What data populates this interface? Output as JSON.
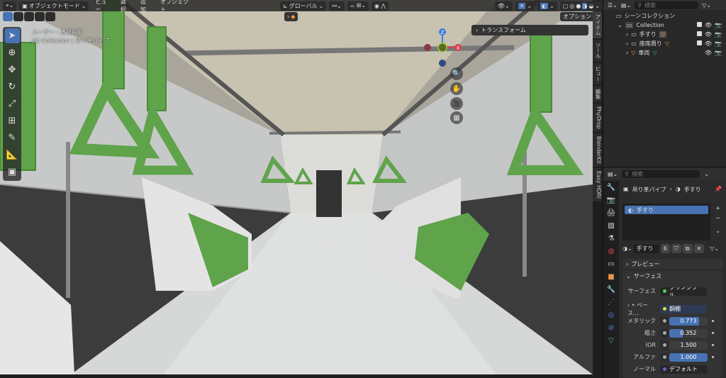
{
  "header": {
    "mode": "オブジェクトモード",
    "menus": [
      "ビュー",
      "選択",
      "追加",
      "オブジェクト"
    ],
    "orientation": "グローバル"
  },
  "viewport": {
    "view_label": "ユーザー・透視投影",
    "object_info": "(0) Collection | 吊り革パイプ",
    "options": "オプション",
    "transform_panel": "トランスフォーム",
    "gizmo": {
      "z": "Z",
      "x": "X"
    }
  },
  "sidebar_tabs": [
    "アイテム",
    "ツール",
    "ビュー",
    "編集",
    "PhyDrop",
    "BlenderKit",
    "Easy HDRI"
  ],
  "outliner": {
    "search_placeholder": "検索",
    "scene_collection": "シーンコレクション",
    "collection": "Collection",
    "items": [
      {
        "name": "手すり"
      },
      {
        "name": "座席周り"
      },
      {
        "name": "車両"
      }
    ]
  },
  "properties": {
    "search_placeholder": "検索",
    "breadcrumb_object": "吊り革パイプ",
    "breadcrumb_material": "手すり",
    "slot": "手すり",
    "material_name": "手すり",
    "users": "6",
    "preview_panel": "プレビュー",
    "surface_panel": "サーフェス",
    "surface": {
      "label": "サーフェス",
      "value": "プリンシプル..."
    },
    "base": {
      "label": "ベース...",
      "value": "鋼棚"
    },
    "metallic": {
      "label": "メタリック",
      "value": "0.773",
      "fraction": 0.773
    },
    "roughness": {
      "label": "粗さ",
      "value": "0.352",
      "fraction": 0.352
    },
    "ior": {
      "label": "IOR",
      "value": "1.500",
      "fraction": 0
    },
    "alpha": {
      "label": "アルファ",
      "value": "1.000",
      "fraction": 1.0
    },
    "normal": {
      "label": "ノーマル",
      "value": "デフォルト"
    }
  },
  "colors": {
    "accent": "#4772b3",
    "green": "#5fa34b",
    "x_axis": "#d9404d",
    "z_axis": "#3f7dd6"
  }
}
